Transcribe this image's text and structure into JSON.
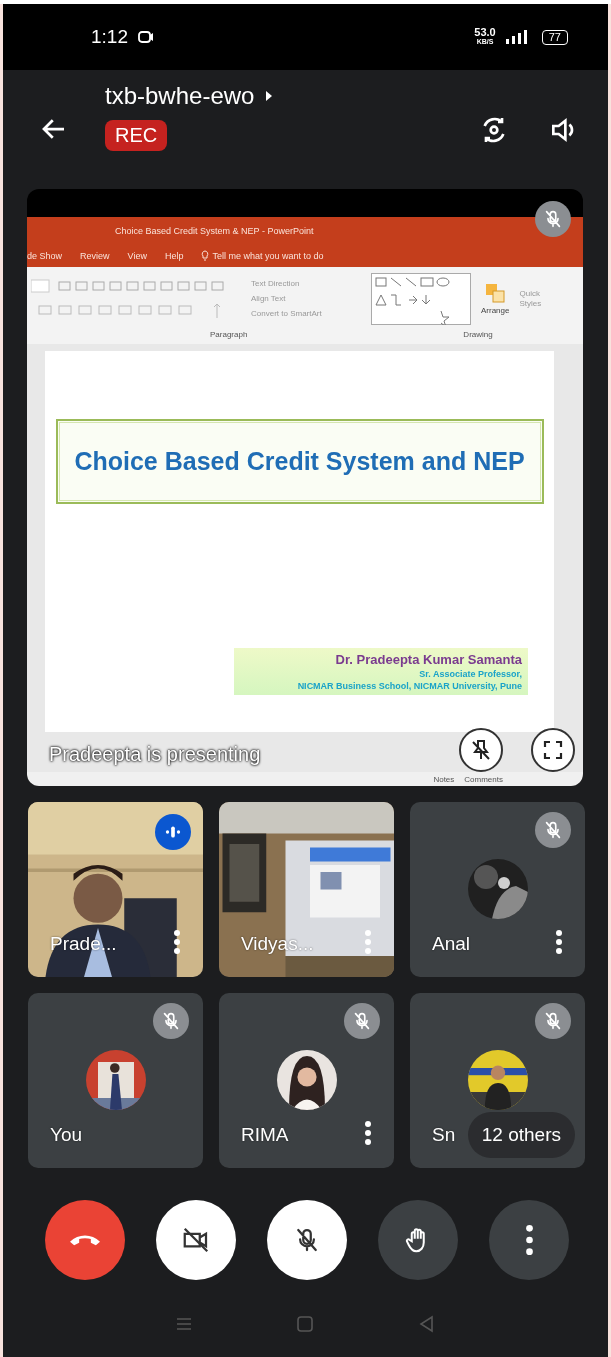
{
  "status_bar": {
    "time": "1:12",
    "speed": "53.0",
    "speed_unit": "KB/S",
    "battery": "77"
  },
  "header": {
    "meeting_code": "txb-bwhe-ewo",
    "recording": "REC"
  },
  "presentation": {
    "muted": true,
    "ppt_title": "Choice Based Credit System & NEP  -  PowerPoint",
    "ribbon_tabs": [
      "de Show",
      "Review",
      "View",
      "Help"
    ],
    "tell_me": "Tell me what you want to do",
    "paragraph_items": [
      "Text Direction",
      "Align Text",
      "Convert to SmartArt"
    ],
    "arrange": "Arrange",
    "quick_styles": "Quick Styles",
    "groups": [
      "Paragraph",
      "Drawing"
    ],
    "slide_title": "Choice Based Credit System and NEP",
    "author": "Dr. Pradeepta Kumar Samanta",
    "author_role": "Sr. Associate Professor,",
    "author_org": "NICMAR Business School, NICMAR University, Pune",
    "notes": "Notes",
    "comments": "Comments",
    "presenting_label": "Pradeepta is presenting"
  },
  "tiles": [
    {
      "name": "Prade...",
      "kind": "video",
      "muted": false,
      "speaking": true,
      "more": true
    },
    {
      "name": "Vidyas...",
      "kind": "video",
      "muted": false,
      "speaking": false,
      "more": true
    },
    {
      "name": "Anal",
      "kind": "avatar",
      "muted": true,
      "speaking": false,
      "more": true
    },
    {
      "name": "You",
      "kind": "avatar",
      "muted": true,
      "speaking": false,
      "more": false
    },
    {
      "name": "RIMA",
      "kind": "avatar",
      "muted": true,
      "speaking": false,
      "more": true
    },
    {
      "name": "Sn",
      "kind": "avatar",
      "muted": true,
      "speaking": false,
      "more": false,
      "others": "12 others"
    }
  ],
  "controls": [
    {
      "kind": "end"
    },
    {
      "kind": "camera",
      "on": false
    },
    {
      "kind": "mic",
      "on": false
    },
    {
      "kind": "hand"
    },
    {
      "kind": "more"
    }
  ]
}
